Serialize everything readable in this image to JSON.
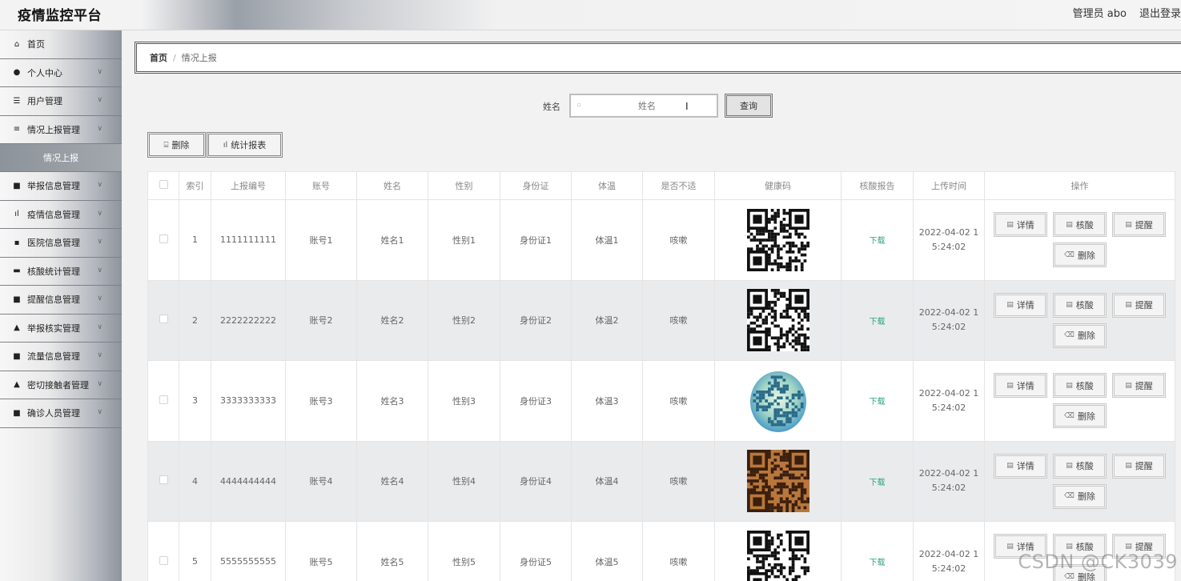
{
  "header": {
    "title": "疫情监控平台",
    "user": "管理员 abo",
    "logout": "退出登录"
  },
  "sidebar": {
    "items": [
      {
        "label": "首页",
        "icon": "home-icon",
        "glyph": "⌂",
        "chevron": false
      },
      {
        "label": "个人中心",
        "icon": "user-icon",
        "glyph": "●",
        "chevron": true
      },
      {
        "label": "用户管理",
        "icon": "list-icon",
        "glyph": "☰",
        "chevron": true
      },
      {
        "label": "情况上报管理",
        "icon": "sliders-icon",
        "glyph": "≡",
        "chevron": true
      }
    ],
    "active_sub": "情况上报",
    "items2": [
      {
        "label": "举报信息管理",
        "icon": "grid-icon",
        "glyph": "■",
        "chevron": true
      },
      {
        "label": "疫情信息管理",
        "icon": "bar-chart-icon",
        "glyph": "ıl",
        "chevron": true
      },
      {
        "label": "医院信息管理",
        "icon": "hospital-icon",
        "glyph": "▪",
        "chevron": true
      },
      {
        "label": "核酸统计管理",
        "icon": "comment-icon",
        "glyph": "▬",
        "chevron": true
      },
      {
        "label": "提醒信息管理",
        "icon": "grid-icon",
        "glyph": "■",
        "chevron": true
      },
      {
        "label": "举报核实管理",
        "icon": "thumb-icon",
        "glyph": "▲",
        "chevron": true
      },
      {
        "label": "流量信息管理",
        "icon": "grid-icon",
        "glyph": "■",
        "chevron": true
      },
      {
        "label": "密切接触者管理",
        "icon": "person-icon",
        "glyph": "▲",
        "chevron": true
      },
      {
        "label": "确诊人员管理",
        "icon": "grid-icon",
        "glyph": "■",
        "chevron": true
      }
    ]
  },
  "breadcrumb": {
    "home": "首页",
    "sep": "/",
    "current": "情况上报"
  },
  "search": {
    "label": "姓名",
    "placeholder": "姓名",
    "button": "查询"
  },
  "toolbar": {
    "delete": "删除",
    "stats": "统计报表"
  },
  "table": {
    "headers": [
      "",
      "索引",
      "上报编号",
      "账号",
      "姓名",
      "性别",
      "身份证",
      "体温",
      "是否不适",
      "健康码",
      "核酸报告",
      "上传时间",
      "操作"
    ],
    "rows": [
      {
        "index": "1",
        "code": "1111111111",
        "account": "账号1",
        "name": "姓名1",
        "gender": "性别1",
        "id": "身份证1",
        "temp": "体温1",
        "unwell": "咳嗽",
        "qr": "plain",
        "report": "下载",
        "time1": "2022-04-02 1",
        "time2": "5:24:02"
      },
      {
        "index": "2",
        "code": "2222222222",
        "account": "账号2",
        "name": "姓名2",
        "gender": "性别2",
        "id": "身份证2",
        "temp": "体温2",
        "unwell": "咳嗽",
        "qr": "plain2",
        "report": "下载",
        "time1": "2022-04-02 1",
        "time2": "5:24:02"
      },
      {
        "index": "3",
        "code": "3333333333",
        "account": "账号3",
        "name": "姓名3",
        "gender": "性别3",
        "id": "身份证3",
        "temp": "体温3",
        "unwell": "咳嗽",
        "qr": "circle",
        "report": "下载",
        "time1": "2022-04-02 1",
        "time2": "5:24:02"
      },
      {
        "index": "4",
        "code": "4444444444",
        "account": "账号4",
        "name": "姓名4",
        "gender": "性别4",
        "id": "身份证4",
        "temp": "体温4",
        "unwell": "咳嗽",
        "qr": "wood",
        "report": "下载",
        "time1": "2022-04-02 1",
        "time2": "5:24:02"
      },
      {
        "index": "5",
        "code": "5555555555",
        "account": "账号5",
        "name": "姓名5",
        "gender": "性别5",
        "id": "身份证5",
        "temp": "体温5",
        "unwell": "咳嗽",
        "qr": "plain",
        "report": "下载",
        "time1": "2022-04-02 1",
        "time2": "5:24:02"
      }
    ],
    "ops": {
      "detail": "详情",
      "nucleic": "核酸",
      "remind": "提醒",
      "delete": "删除"
    }
  },
  "watermark": "CSDN @CK3039"
}
